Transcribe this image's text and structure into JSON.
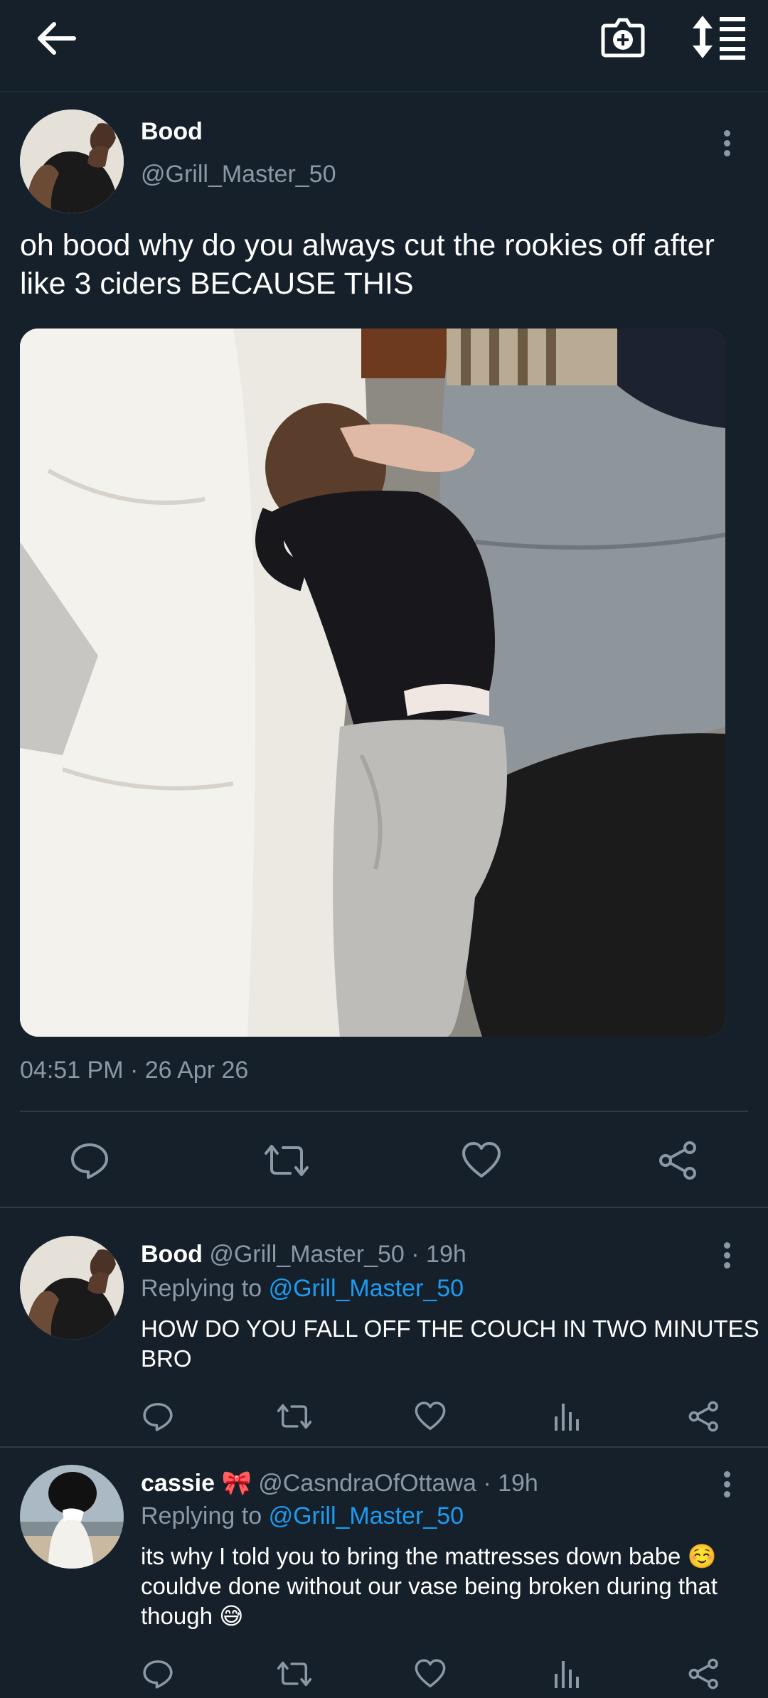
{
  "header": {
    "back_icon": "arrow-left-icon",
    "camera_icon": "add-photo-icon",
    "sort_icon": "sort-icon"
  },
  "tweet": {
    "author_name": "Bood",
    "author_handle": "@Grill_Master_50",
    "text": "oh bood why do you always cut the rookies off after like 3 ciders BECAUSE THIS",
    "timestamp": "04:51 PM · 26 Apr 26",
    "photo_alt": "photo"
  },
  "replies": [
    {
      "name": "Bood",
      "handle": "@Grill_Master_50",
      "time": "· 19h",
      "replying_label": "Replying to",
      "replying_to": "@Grill_Master_50",
      "text": "HOW DO YOU FALL OFF THE COUCH IN TWO MINUTES BRO"
    },
    {
      "name": "cassie 🎀",
      "handle": "@CasndraOfOttawa",
      "time": "· 19h",
      "replying_label": "Replying to",
      "replying_to": "@Grill_Master_50",
      "text": "its why I told you to bring the mattresses down babe ☺️ couldve done without our vase being broken during that though 😅"
    }
  ],
  "colors": {
    "background": "#15202b",
    "muted": "#8b98a5",
    "link": "#1d9bf0"
  }
}
